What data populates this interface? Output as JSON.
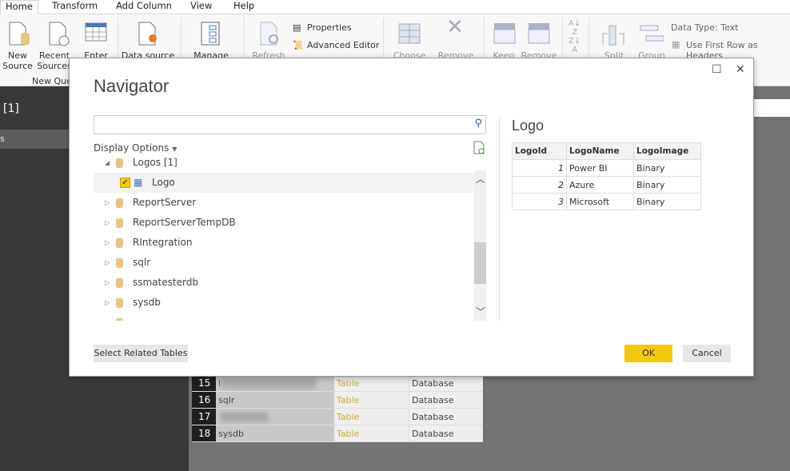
{
  "ribbon_tabs": [
    "Home",
    "Transform",
    "Add Column",
    "View",
    "Help"
  ],
  "ribbon": {
    "new_source": "New Source",
    "recent_sources": "Recent Sources",
    "enter": "Enter",
    "data_source": "Data source",
    "manage": "Manage",
    "refresh": "Refresh",
    "properties": "Properties",
    "advanced_editor": "Advanced Editor",
    "choose": "Choose",
    "remove": "Remove",
    "keep": "Keep",
    "remove2": "Remove",
    "split": "Split",
    "group": "Group",
    "data_type": "Data Type: Text",
    "first_row": "Use First Row as Headers",
    "group_new_query": "New Que"
  },
  "left_pane": {
    "title": "[1]",
    "selected": "s"
  },
  "grid_rows": [
    {
      "num": "15",
      "name": "l",
      "kind": "Table",
      "type": "Database",
      "blurred": true
    },
    {
      "num": "16",
      "name": "sqlr",
      "kind": "Table",
      "type": "Database",
      "blurred": false
    },
    {
      "num": "17",
      "name": "",
      "kind": "Table",
      "type": "Database",
      "blurred": true
    },
    {
      "num": "18",
      "name": "sysdb",
      "kind": "Table",
      "type": "Database",
      "blurred": false
    }
  ],
  "navigator": {
    "title": "Navigator",
    "search_placeholder": "",
    "display_options": "Display Options",
    "tree": [
      {
        "label": "Logos [1]",
        "expanded": true,
        "type": "database"
      },
      {
        "label": "Logo",
        "checked": true,
        "type": "table"
      },
      {
        "label": "ReportServer",
        "type": "database"
      },
      {
        "label": "ReportServerTempDB",
        "type": "database"
      },
      {
        "label": "RIntegration",
        "type": "database"
      },
      {
        "label": "sqlr",
        "type": "database"
      },
      {
        "label": "ssmatesterdb",
        "type": "database"
      },
      {
        "label": "sysdb",
        "type": "database"
      }
    ],
    "preview": {
      "title": "Logo",
      "columns": [
        "LogoId",
        "LogoName",
        "LogoImage"
      ],
      "rows": [
        [
          "1",
          "Power BI",
          "Binary"
        ],
        [
          "2",
          "Azure",
          "Binary"
        ],
        [
          "3",
          "Microsoft",
          "Binary"
        ]
      ]
    },
    "select_related": "Select Related Tables",
    "ok": "OK",
    "cancel": "Cancel"
  },
  "colors": {
    "accent": "#f2c811",
    "db_icon": "#e8c483",
    "table_kind": "#d1aa3a"
  }
}
